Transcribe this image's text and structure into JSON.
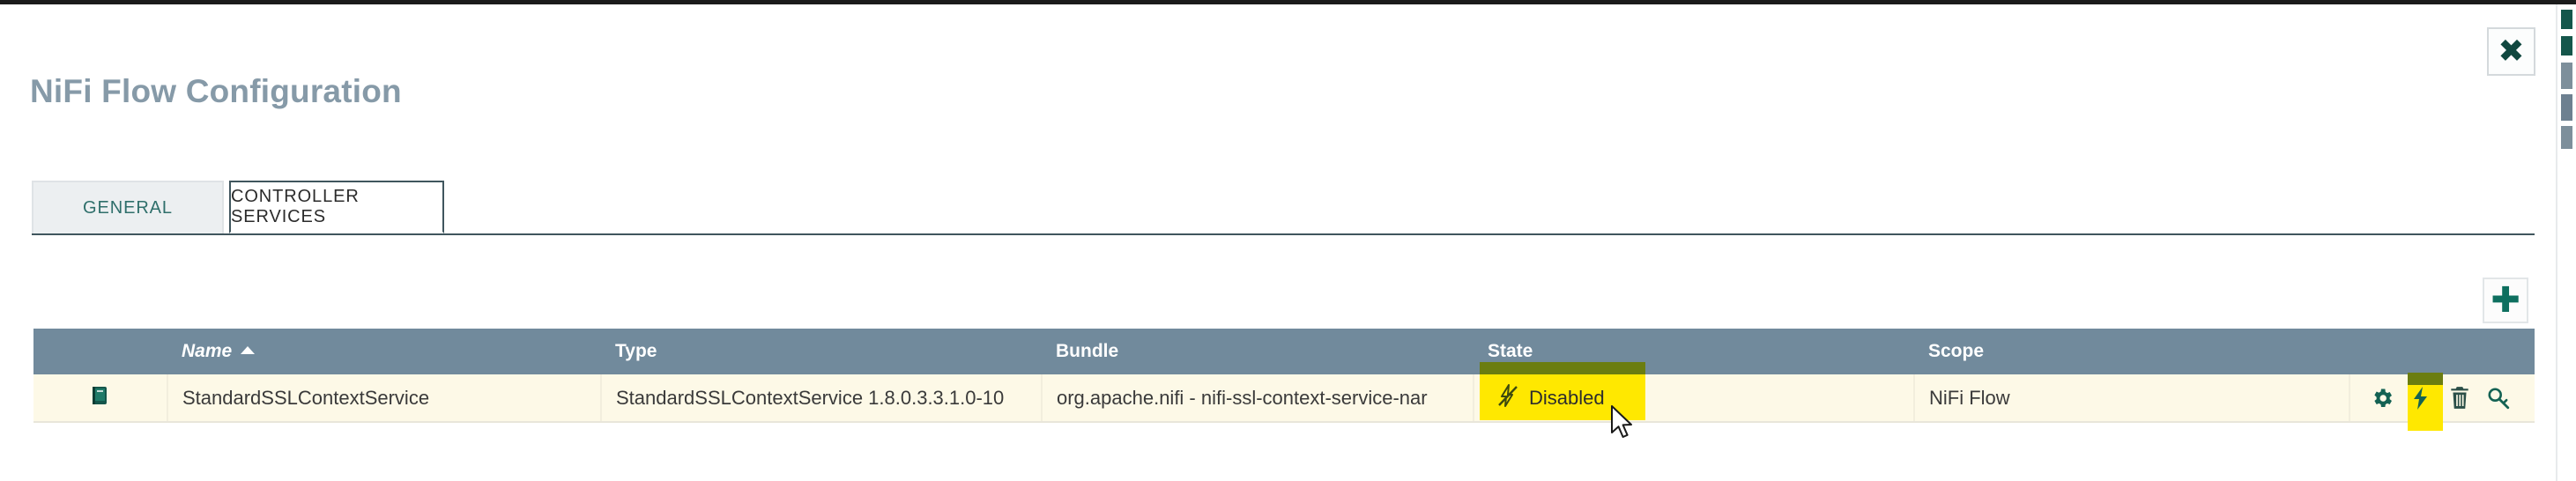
{
  "dialog": {
    "title": "NiFi Flow Configuration",
    "close_label": "✖",
    "close_icon": "close-icon"
  },
  "tabs": [
    {
      "id": "general",
      "label": "GENERAL",
      "active": false
    },
    {
      "id": "controller-services",
      "label": "CONTROLLER SERVICES",
      "active": true
    }
  ],
  "toolbar": {
    "add_label": "✚",
    "add_icon": "plus-icon"
  },
  "table": {
    "columns": [
      {
        "key": "icon",
        "label": ""
      },
      {
        "key": "name",
        "label": "Name",
        "sorted": true,
        "sort_dir": "asc"
      },
      {
        "key": "type",
        "label": "Type"
      },
      {
        "key": "bundle",
        "label": "Bundle"
      },
      {
        "key": "state",
        "label": "State"
      },
      {
        "key": "scope",
        "label": "Scope"
      },
      {
        "key": "actions",
        "label": ""
      }
    ],
    "rows": [
      {
        "doc_icon": "book-icon",
        "name": "StandardSSLContextService",
        "type": "StandardSSLContextService 1.8.0.3.3.1.0-10",
        "bundle": "org.apache.nifi - nifi-ssl-context-service-nar",
        "state": "Disabled",
        "state_icon": "flash-off-icon",
        "state_highlighted": true,
        "scope": "NiFi Flow",
        "actions": [
          {
            "name": "settings-icon",
            "title": "Configure",
            "highlighted": false
          },
          {
            "name": "enable-icon",
            "title": "Enable",
            "highlighted": true
          },
          {
            "name": "delete-icon",
            "title": "Delete",
            "highlighted": false
          },
          {
            "name": "usage-icon",
            "title": "View Usage",
            "highlighted": false
          }
        ]
      }
    ]
  },
  "colors": {
    "title": "#869aa8",
    "header_bg": "#718a9c",
    "row_bg": "#fdf9e7",
    "accent_teal": "#0e6f5f",
    "tab_active_border": "#40565e",
    "highlight_yellow": "#ffe800",
    "highlight_cap": "#6b7d10"
  }
}
